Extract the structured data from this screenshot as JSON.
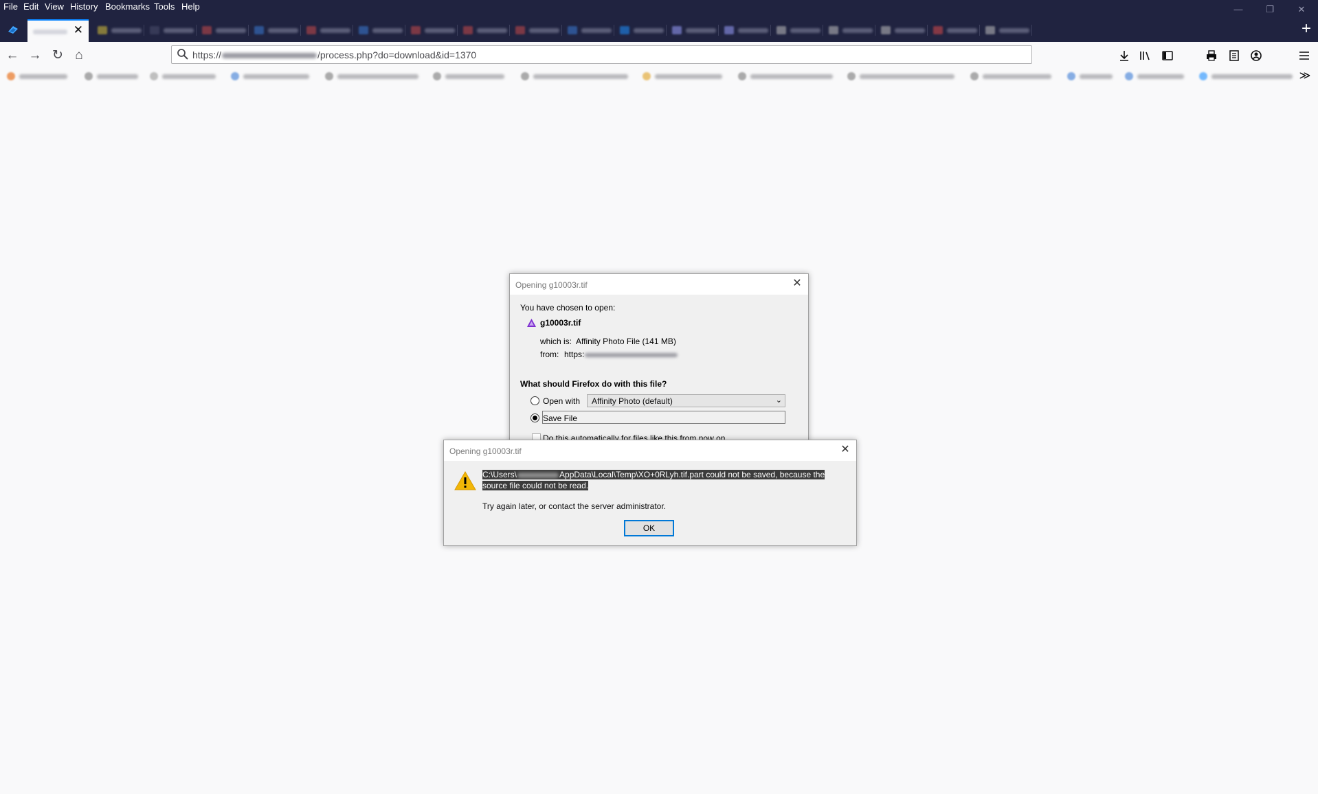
{
  "menubar": {
    "items": [
      "File",
      "Edit",
      "View",
      "History",
      "Bookmarks",
      "Tools",
      "Help"
    ]
  },
  "window_controls": {
    "minimize": "—",
    "restore": "❐",
    "close": "✕"
  },
  "tabs": {
    "close_glyph": "✕",
    "new_tab_glyph": "+"
  },
  "nav": {
    "back_glyph": "←",
    "forward_glyph": "→",
    "reload_glyph": "↻",
    "home_glyph": "⌂",
    "url_prefix": "https://",
    "url_suffix": "/process.php?do=download&id=1370"
  },
  "toolbar_icons": [
    "download-icon",
    "library-icon",
    "sidebar-icon",
    "print-icon",
    "reader-icon",
    "account-icon",
    "menu-icon"
  ],
  "bookmarks": {
    "overflow_glyph": "≫"
  },
  "dialog_open": {
    "title": "Opening g10003r.tif",
    "chosen_label": "You have chosen to open:",
    "file_name": "g10003r.tif",
    "which_is_label": "which is:",
    "which_is_value": "Affinity Photo File (141 MB)",
    "from_label": "from:",
    "from_value": "https:",
    "question": "What should Firefox do with this file?",
    "open_with_label": "Open with",
    "open_with_value": "Affinity Photo (default)",
    "save_file_label": "Save File",
    "auto_label": "Do this automatically for files like this from now on."
  },
  "dialog_error": {
    "title": "Opening g10003r.tif",
    "message_part1": "C:\\Users\\",
    "message_part2": "AppData\\Local\\Temp\\XO+0RLyh.tif.part could not be saved, because the source file could not be read.",
    "message_secondary": "Try again later, or contact the server administrator.",
    "ok_label": "OK"
  },
  "colors": {
    "titlebar_bg": "#202340",
    "accent": "#0a84ff",
    "warning": "#f2b707",
    "affinity_purple": "#7e2fd0"
  }
}
